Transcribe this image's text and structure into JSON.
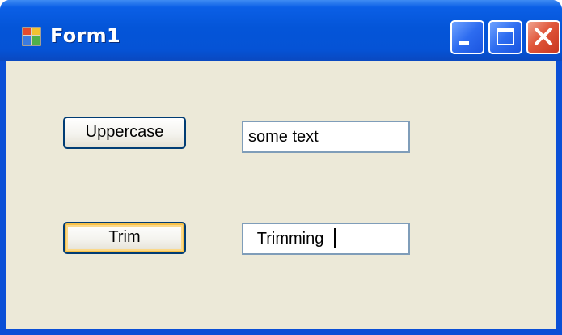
{
  "window": {
    "title": "Form1",
    "controls": [
      "minimize",
      "maximize",
      "close"
    ]
  },
  "form": {
    "uppercase_button_label": "Uppercase",
    "trim_button_label": "Trim",
    "textbox1_value": "some text",
    "textbox2_value": "  Trimming  "
  },
  "colors": {
    "titlebar": "#0553d6",
    "client_background": "#ece9d8",
    "close_button": "#e0563a",
    "button_border": "#003c74",
    "focus_highlight": "#f7c14a",
    "textbox_border": "#7f9db9"
  }
}
